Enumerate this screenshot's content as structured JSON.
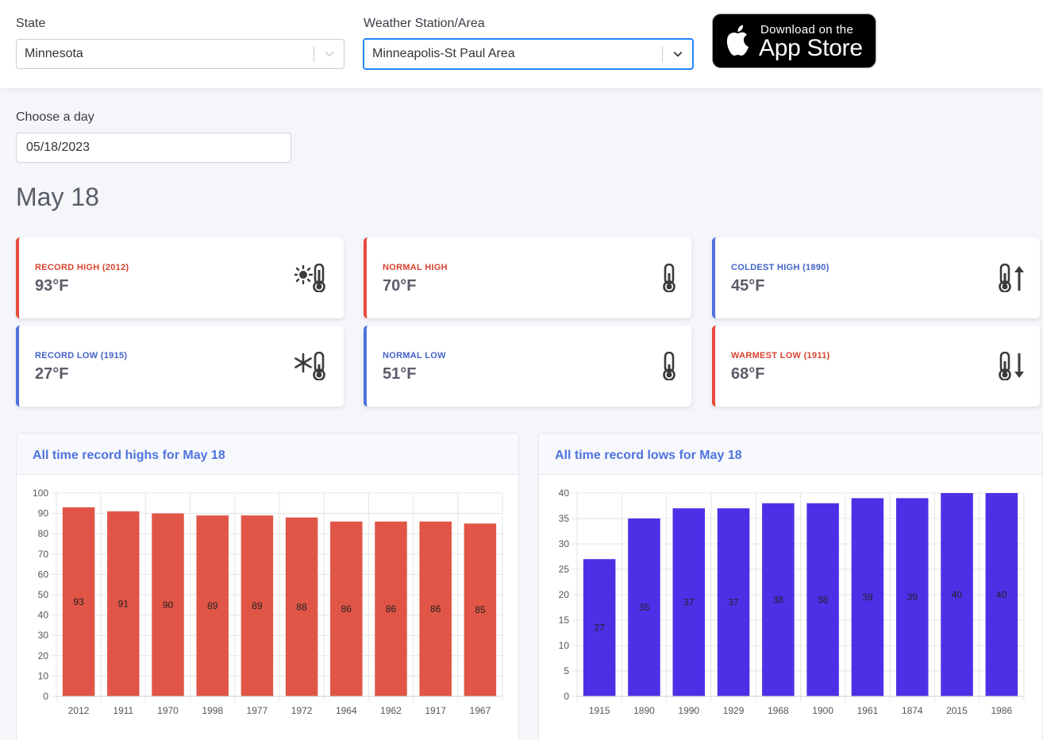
{
  "filters": {
    "state_label": "State",
    "state_value": "Minnesota",
    "station_label": "Weather Station/Area",
    "station_value": "Minneapolis-St Paul Area"
  },
  "app_store": {
    "line1": "Download on the",
    "line2": "App Store"
  },
  "day_picker": {
    "label": "Choose a day",
    "value": "05/18/2023"
  },
  "day_title": "May 18",
  "stats": [
    {
      "label": "RECORD HIGH (2012)",
      "value": "93°F",
      "color": "#e74a3b",
      "icon": "sun-thermometer-icon"
    },
    {
      "label": "NORMAL HIGH",
      "value": "70°F",
      "color": "#e74a3b",
      "icon": "thermometer-icon"
    },
    {
      "label": "COLDEST HIGH (1890)",
      "value": "45°F",
      "color": "#4e73df",
      "icon": "thermometer-arrow-up-icon"
    },
    {
      "label": "RECORD LOW (1915)",
      "value": "27°F",
      "color": "#4e73df",
      "icon": "snowflake-thermometer-icon"
    },
    {
      "label": "NORMAL LOW",
      "value": "51°F",
      "color": "#4e73df",
      "icon": "thermometer-icon"
    },
    {
      "label": "WARMEST LOW (1911)",
      "value": "68°F",
      "color": "#e74a3b",
      "icon": "thermometer-arrow-down-icon"
    }
  ],
  "charts": {
    "highs_title": "All time record highs for May 18",
    "lows_title": "All time record lows for May 18"
  },
  "chart_data": [
    {
      "type": "bar",
      "title": "All time record highs for May 18",
      "categories": [
        "2012",
        "1911",
        "1970",
        "1998",
        "1977",
        "1972",
        "1964",
        "1962",
        "1917",
        "1967"
      ],
      "values": [
        93,
        91,
        90,
        89,
        89,
        88,
        86,
        86,
        86,
        85
      ],
      "ylim": [
        0,
        100
      ],
      "yticks": [
        0,
        10,
        20,
        30,
        40,
        50,
        60,
        70,
        80,
        90,
        100
      ],
      "color": "#e05546",
      "grid": true,
      "data_labels": true
    },
    {
      "type": "bar",
      "title": "All time record lows for May 18",
      "categories": [
        "1915",
        "1890",
        "1990",
        "1929",
        "1968",
        "1900",
        "1961",
        "1874",
        "2015",
        "1986"
      ],
      "values": [
        27,
        35,
        37,
        37,
        38,
        38,
        39,
        39,
        40,
        40
      ],
      "ylim": [
        0,
        40
      ],
      "yticks": [
        0,
        5,
        10,
        15,
        20,
        25,
        30,
        35,
        40
      ],
      "color": "#4f2fe6",
      "grid": true,
      "data_labels": true
    }
  ]
}
